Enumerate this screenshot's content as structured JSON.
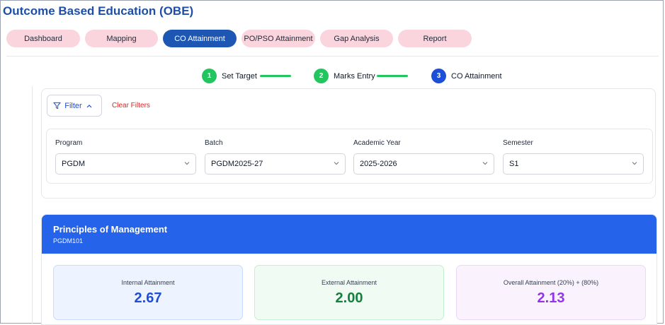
{
  "app": {
    "title": "Outcome Based Education (OBE)"
  },
  "tabs": [
    {
      "label": "Dashboard",
      "active": false
    },
    {
      "label": "Mapping",
      "active": false
    },
    {
      "label": "CO Attainment",
      "active": true
    },
    {
      "label": "PO/PSO Attainment",
      "active": false
    },
    {
      "label": "Gap Analysis",
      "active": false
    },
    {
      "label": "Report",
      "active": false
    }
  ],
  "stepper": {
    "steps": [
      {
        "number": "1",
        "label": "Set Target",
        "status": "done"
      },
      {
        "number": "2",
        "label": "Marks Entry",
        "status": "done"
      },
      {
        "number": "3",
        "label": "CO Attainment",
        "status": "current"
      }
    ]
  },
  "filter": {
    "button_label": "Filter",
    "clear_label": "Clear Filters",
    "fields": [
      {
        "label": "Program",
        "value": "PGDM"
      },
      {
        "label": "Batch",
        "value": "PGDM2025-27"
      },
      {
        "label": "Academic Year",
        "value": "2025-2026"
      },
      {
        "label": "Semester",
        "value": "S1"
      }
    ]
  },
  "course": {
    "name": "Principles of Management",
    "code": "PGDM101",
    "metrics": [
      {
        "label": "Internal Attainment",
        "value": "2.67"
      },
      {
        "label": "External Attainment",
        "value": "2.00"
      },
      {
        "label": "Overall Attainment (20%) + (80%)",
        "value": "2.13"
      }
    ]
  },
  "colors": {
    "brand_blue": "#1e56b4",
    "tab_pink": "#fbd5de",
    "step_done": "#22c55e",
    "step_current": "#1d4ed8",
    "course_header": "#2563eb",
    "clear_red": "#dc2626"
  }
}
